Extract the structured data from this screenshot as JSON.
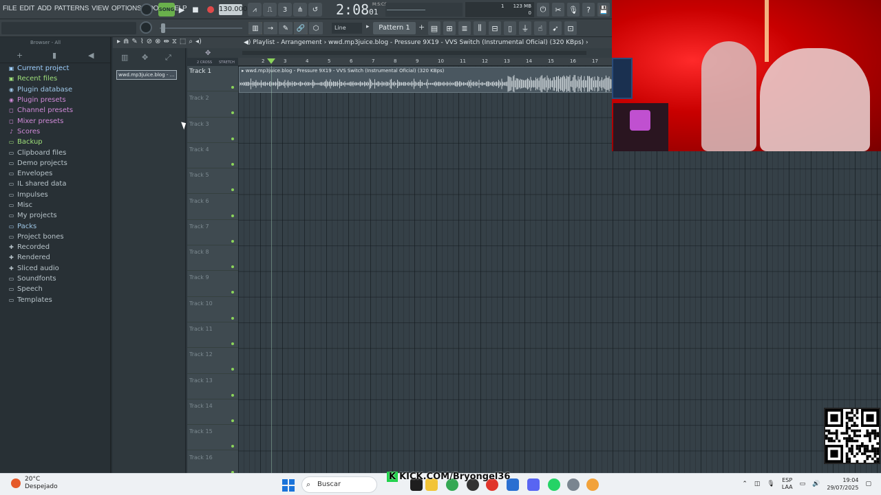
{
  "menu": [
    "FILE",
    "EDIT",
    "ADD",
    "PATTERNS",
    "VIEW",
    "OPTIONS",
    "TOOLS",
    "HELP"
  ],
  "transport": {
    "song_label": "SONG",
    "play_icon": "play-icon",
    "stop_icon": "stop-icon",
    "record_icon": "record-icon",
    "tempo": "130.000",
    "time_main": "2:08",
    "time_sub": "01",
    "time_unit": "M:S:CS"
  },
  "cpu": {
    "value": "1",
    "memory": "123 MB",
    "polyphony": "0"
  },
  "toolbar2": {
    "snap": "Line",
    "pattern": "Pattern 1"
  },
  "browser": {
    "header": "Browser - All",
    "items": [
      {
        "label": "Current project",
        "icon": "project-icon",
        "color": "#9fd0ff"
      },
      {
        "label": "Recent files",
        "icon": "recent-icon",
        "color": "#9fe07a"
      },
      {
        "label": "Plugin database",
        "icon": "plug-icon",
        "color": "#9fc8e8"
      },
      {
        "label": "Plugin presets",
        "icon": "plug-preset-icon",
        "color": "#d08ad8"
      },
      {
        "label": "Channel presets",
        "icon": "channel-preset-icon",
        "color": "#d08ad8"
      },
      {
        "label": "Mixer presets",
        "icon": "mixer-preset-icon",
        "color": "#d08ad8"
      },
      {
        "label": "Scores",
        "icon": "note-icon",
        "color": "#d08ad8"
      },
      {
        "label": "Backup",
        "icon": "folder-icon",
        "color": "#9fe07a"
      },
      {
        "label": "Clipboard files",
        "icon": "folder-icon",
        "color": "#b8c4ca"
      },
      {
        "label": "Demo projects",
        "icon": "folder-icon",
        "color": "#b8c4ca"
      },
      {
        "label": "Envelopes",
        "icon": "folder-icon",
        "color": "#b8c4ca"
      },
      {
        "label": "IL shared data",
        "icon": "folder-icon",
        "color": "#b8c4ca"
      },
      {
        "label": "Impulses",
        "icon": "folder-icon",
        "color": "#b8c4ca"
      },
      {
        "label": "Misc",
        "icon": "folder-icon",
        "color": "#b8c4ca"
      },
      {
        "label": "My projects",
        "icon": "folder-icon",
        "color": "#b8c4ca"
      },
      {
        "label": "Packs",
        "icon": "folder-icon",
        "color": "#9fc8e8"
      },
      {
        "label": "Project bones",
        "icon": "folder-icon",
        "color": "#b8c4ca"
      },
      {
        "label": "Recorded",
        "icon": "plus-icon",
        "color": "#b8c4ca"
      },
      {
        "label": "Rendered",
        "icon": "plus-icon",
        "color": "#b8c4ca"
      },
      {
        "label": "Sliced audio",
        "icon": "plus-icon",
        "color": "#b8c4ca"
      },
      {
        "label": "Soundfonts",
        "icon": "folder-icon",
        "color": "#b8c4ca"
      },
      {
        "label": "Speech",
        "icon": "folder-icon",
        "color": "#b8c4ca"
      },
      {
        "label": "Templates",
        "icon": "folder-icon",
        "color": "#b8c4ca"
      }
    ]
  },
  "picker": {
    "clip_source": "wwd.mp3juice.blog - ..."
  },
  "playlist": {
    "title": "Playlist - Arrangement",
    "path": "wwd.mp3juice.blog - Pressure 9X19 - VVS Switch (Instrumental Oficial) (320 KBps)",
    "ruler_labels": [
      "2 CROSS",
      "STRETCH"
    ],
    "bars": [
      "2",
      "3",
      "4",
      "5",
      "6",
      "7",
      "8",
      "9",
      "10",
      "11",
      "12",
      "13",
      "14",
      "15",
      "16",
      "17"
    ],
    "tracks": [
      "Track 1",
      "Track 2",
      "Track 3",
      "Track 4",
      "Track 5",
      "Track 6",
      "Track 7",
      "Track 8",
      "Track 9",
      "Track 10",
      "Track 11",
      "Track 12",
      "Track 13",
      "Track 14",
      "Track 15",
      "Track 16"
    ],
    "clip_label": "wwd.mp3juice.blog - Pressure 9X19 - VVS Switch (Instrumental Oficial) (320 KBps)",
    "playhead_bar": 2.5
  },
  "taskbar": {
    "temp": "20°C",
    "weather": "Despejado",
    "search": "Buscar",
    "kick": "KICK.COM/Bryongel36",
    "lang_1": "ESP",
    "lang_2": "LAA",
    "time": "19:04",
    "date": "29/07/2025"
  }
}
